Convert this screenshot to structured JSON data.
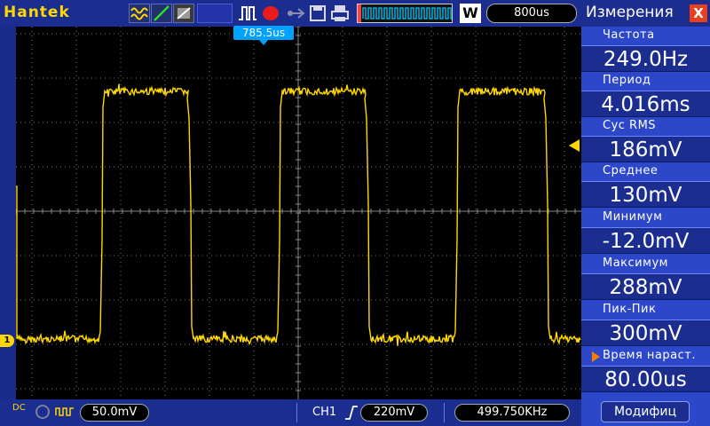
{
  "header": {
    "brand": "Hantek",
    "timebase": "800us",
    "window_button": "W"
  },
  "screen": {
    "trigger_position": "785.5us",
    "channel_marker": "1",
    "trace_color": "#ffd800"
  },
  "measurements": {
    "title": "Измерения",
    "close_label": "X",
    "items": [
      {
        "label": "Частота",
        "value": "249.0Hz"
      },
      {
        "label": "Период",
        "value": "4.016ms"
      },
      {
        "label": "Cyc RMS",
        "value": "186mV"
      },
      {
        "label": "Среднее",
        "value": "130mV"
      },
      {
        "label": "Минимум",
        "value": "-12.0mV"
      },
      {
        "label": "Максимум",
        "value": "288mV"
      },
      {
        "label": "Пик-Пик",
        "value": "300mV"
      },
      {
        "label": "Время нараст.",
        "value": "80.00us"
      }
    ],
    "modify_button": "Модифиц"
  },
  "footer": {
    "coupling": "DC",
    "volts_div": "50.0mV",
    "channel": "CH1",
    "trigger_level": "220mV",
    "frequency": "499.750KHz"
  }
}
